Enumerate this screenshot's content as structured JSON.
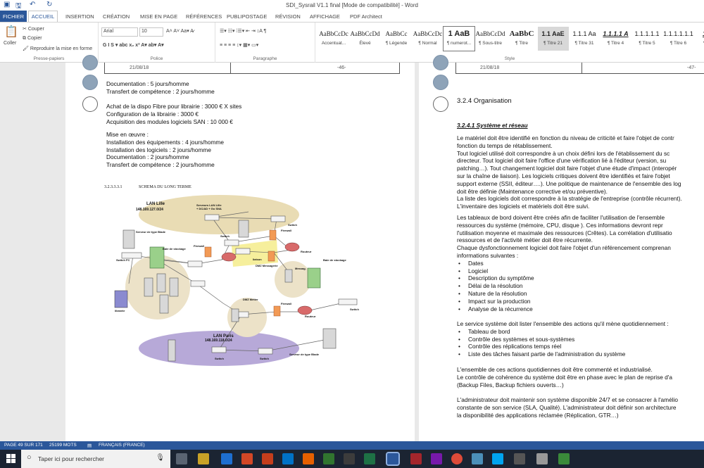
{
  "title_bar": {
    "title": "SDI_Sysrail V1.1 final [Mode de compatibilité] - Word"
  },
  "tabs": [
    "FICHIER",
    "ACCUEIL",
    "INSERTION",
    "CRÉATION",
    "MISE EN PAGE",
    "RÉFÉRENCES",
    "PUBLIPOSTAGE",
    "RÉVISION",
    "AFFICHAGE",
    "PDF Architect"
  ],
  "ribbon": {
    "clipboard": {
      "paste": "Coller",
      "cut": "Couper",
      "copy": "Copier",
      "format_painter": "Reproduire la mise en forme",
      "label": "Presse-papiers"
    },
    "font": {
      "name": "Arial",
      "size": "10",
      "label": "Police"
    },
    "paragraph": {
      "label": "Paragraphe"
    },
    "styles": {
      "label": "Style",
      "items": [
        {
          "preview": "AaBbCcDc",
          "name": "Accentuat..."
        },
        {
          "preview": "AaBbCcDd",
          "name": "Élevé"
        },
        {
          "preview": "AaBbCc",
          "name": "¶ Légende"
        },
        {
          "preview": "AaBbCcDc",
          "name": "¶ Normal"
        },
        {
          "preview": "1 AaB",
          "name": "¶ numerot..."
        },
        {
          "preview": "AaBbCcDd",
          "name": "¶ Sous-titre"
        },
        {
          "preview": "AaBbC",
          "name": "¶ Titre"
        },
        {
          "preview": "1.1 AaE",
          "name": "¶ Titre 21"
        },
        {
          "preview": "1.1.1 Aa",
          "name": "¶ Titre 31"
        },
        {
          "preview": "1.1.1.1 A",
          "name": "¶ Titre 4"
        },
        {
          "preview": "1.1.1.1.1",
          "name": "¶ Titre 5"
        },
        {
          "preview": "1.1.1.1.1.1",
          "name": "¶ Titre 6"
        },
        {
          "preview": "1.1.1",
          "name": "¶ Titre"
        }
      ]
    }
  },
  "page1": {
    "header_date": "21/08/18",
    "header_page": "-46-",
    "lines_a": [
      "Documentation : 5 jours/homme",
      "Transfert de compétence : 2 jours/homme"
    ],
    "lines_b": [
      "Achat de la dispo Fibre pour librairie : 3000 € X sites",
      "Configuration de la librairie : 3000 €",
      "Acquisition des modules logiciels SAN : 10 000 €"
    ],
    "lines_c": [
      "Mise en œuvre :",
      "Installation des équipements : 4 jours/homme",
      "Installation des logiciels : 2 jours/homme",
      "Documentation : 2 jours/homme",
      "Transfert de compétence : 2 jours/homme"
    ],
    "schema_num": "3.2.3.3.3.1",
    "schema_title": "SCHEMA DU LONG TERME",
    "diagram": {
      "lan_lille": "LAN Lille",
      "lan_lille_ip": "148.169.127.0/24",
      "servers_lille": "Serveurs LAN Lille",
      "servers_lille_sub": "+ DC/AD + Go SNA",
      "blade1": "Serveur de type Blade",
      "storage1": "Baie de stockage",
      "switch": "Switch",
      "switch_fc": "Switch FC",
      "firewall": "Firewall",
      "routeur": "Routeur",
      "liaison": "liaison",
      "dmz": "DMZ Messagerie",
      "storage2": "Baie de stockage",
      "librairie": "librairie",
      "dmz_metier": "DMZ Métier",
      "messagerie": "Messag.",
      "lan_paris": "LAN Paris",
      "lan_paris_ip": "148.169.118.0/24",
      "blade2": "Serveur de type Blade"
    }
  },
  "page2": {
    "header_date": "21/08/18",
    "header_page": "-47-",
    "heading": "3.2.4  Organisation",
    "subheading": "3.2.4.1 Système et réseau",
    "para1": [
      "Le matériel doit être identifié en fonction du niveau de criticité et faire l'objet de contr",
      "fonction du temps de rétablissement.",
      "Tout logiciel utilisé doit correspondre à un choix défini lors de l'établissement du sc",
      "directeur. Tout logiciel doit faire l'office d'une vérification lié à l'éditeur (version, su",
      "patching…). Tout changement logiciel doit faire l'objet d'une étude d'impact (interopér",
      "sur la chaîne de liaison). Les logiciels critiques doivent être identifiés et faire l'objet",
      "support externe (SSII, éditeur….). Une politique de maintenance de l'ensemble des log",
      "doit être définie (Maintenance corrective et/ou préventive).",
      "La liste des logiciels doit correspondre à la stratégie de l'entreprise (contrôle récurrent).",
      "L'inventaire des logiciels et matériels doit être suivi."
    ],
    "para2": [
      "Les tableaux de bord doivent être créés afin de faciliter l'utilisation de l'ensemble",
      "ressources du système (mémoire, CPU, disque ). Ces informations devront repr",
      "l'utilisation moyenne et maximale des ressources (Crêtes). La corrélation d'utilisatio",
      "ressources et de l'activité métier doit être récurrente.",
      "Chaque dysfonctionnement logiciel doit faire l'objet d'un référencement comprenan",
      "informations suivantes :"
    ],
    "bullets1": [
      "Dates",
      "Logiciel",
      "Description du symptôme",
      "Délai de la résolution",
      "Nature de la résolution",
      "Impact sur la production",
      "Analyse de la récurrence"
    ],
    "para3": "Le service système doit lister l'ensemble des actions qu'il mène quotidiennement :",
    "bullets2": [
      "Tableau de bord",
      "Contrôle des systèmes et sous-systèmes",
      "Contrôle des réplications temps réel",
      "Liste des tâches faisant partie de l'administration du système"
    ],
    "para4": [
      "L'ensemble de ces actions quotidiennes doit être commenté et industrialisé.",
      "Le contrôle de cohérence du système doit être en phase avec le plan de reprise d'a",
      "(Backup Files, Backup fichiers ouverts…)"
    ],
    "para5": [
      "L'administrateur doit maintenir son système disponible 24/7 et se consacrer à l'amélio",
      "constante de son service (SLA, Qualité). L'administrateur doit définir son architecture",
      "la disponibilité des applications réclamée (Réplication, GTR…)"
    ]
  },
  "status": {
    "page": "PAGE 49 SUR 171",
    "words": "25199 MOTS",
    "lang": "FRANÇAIS (FRANCE)"
  },
  "taskbar": {
    "search_placeholder": "Taper ici pour rechercher"
  }
}
